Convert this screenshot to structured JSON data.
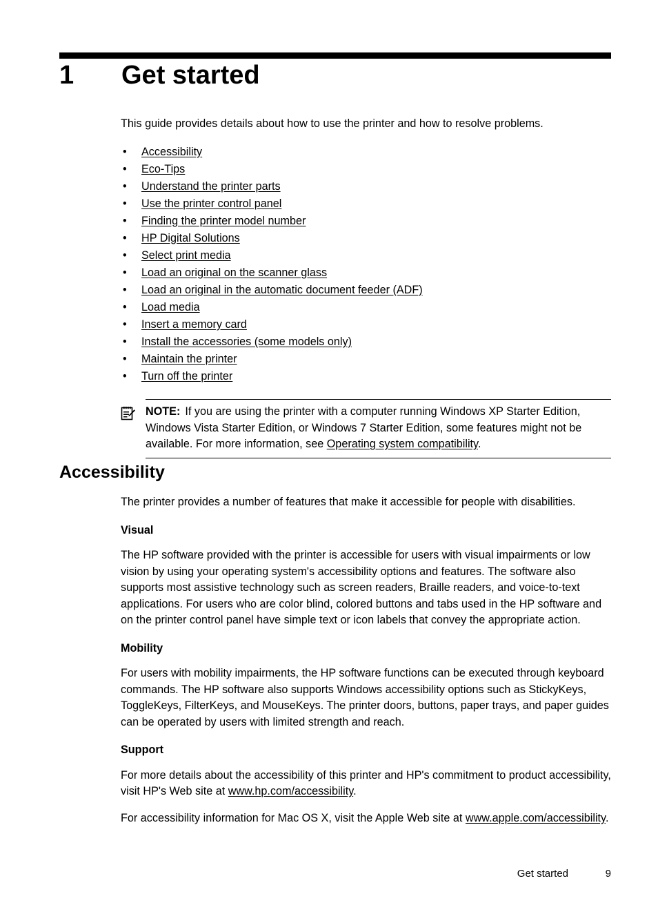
{
  "chapter": {
    "number": "1",
    "title": "Get started"
  },
  "intro": {
    "paragraph": "This guide provides details about how to use the printer and how to resolve problems."
  },
  "toc_links": [
    {
      "bullet": "•",
      "label": "Accessibility"
    },
    {
      "bullet": "•",
      "label": "Eco-Tips"
    },
    {
      "bullet": "•",
      "label": "Understand the printer parts"
    },
    {
      "bullet": "•",
      "label": "Use the printer control panel"
    },
    {
      "bullet": "•",
      "label": "Finding the printer model number"
    },
    {
      "bullet": "•",
      "label": "HP Digital Solutions"
    },
    {
      "bullet": "•",
      "label": "Select print media"
    },
    {
      "bullet": "•",
      "label": "Load an original on the scanner glass"
    },
    {
      "bullet": "•",
      "label": "Load an original in the automatic document feeder (ADF)"
    },
    {
      "bullet": "•",
      "label": "Load media"
    },
    {
      "bullet": "•",
      "label": "Insert a memory card"
    },
    {
      "bullet": "•",
      "label": "Install the accessories (some models only)"
    },
    {
      "bullet": "•",
      "label": "Maintain the printer"
    },
    {
      "bullet": "•",
      "label": "Turn off the printer"
    }
  ],
  "note": {
    "icon": "note-pencil-icon",
    "label": "NOTE:",
    "text_before_link": "If you are using the printer with a computer running Windows XP Starter Edition, Windows Vista Starter Edition, or Windows 7 Starter Edition, some features might not be available. For more information, see ",
    "link": "Operating system compatibility",
    "text_after_link": "."
  },
  "section": {
    "heading": "Accessibility",
    "intro": "The printer provides a number of features that make it accessible for people with disabilities.",
    "subsections": [
      {
        "heading": "Visual",
        "paragraph": "The HP software provided with the printer is accessible for users with visual impairments or low vision by using your operating system's accessibility options and features. The software also supports most assistive technology such as screen readers, Braille readers, and voice-to-text applications. For users who are color blind, colored buttons and tabs used in the HP software and on the printer control panel have simple text or icon labels that convey the appropriate action."
      },
      {
        "heading": "Mobility",
        "paragraph": "For users with mobility impairments, the HP software functions can be executed through keyboard commands. The HP software also supports Windows accessibility options such as StickyKeys, ToggleKeys, FilterKeys, and MouseKeys. The printer doors, buttons, paper trays, and paper guides can be operated by users with limited strength and reach."
      }
    ],
    "support": {
      "heading": "Support",
      "para1_before_link": "For more details about the accessibility of this printer and HP's commitment to product accessibility, visit HP's Web site at ",
      "para1_link": "www.hp.com/accessibility",
      "para1_after_link": ".",
      "para2_before_link": "For accessibility information for Mac OS X, visit the Apple Web site at ",
      "para2_link": "www.apple.com/accessibility",
      "para2_after_link": "."
    }
  },
  "footer": {
    "chapter_label": "Get started",
    "page_number": "9"
  }
}
